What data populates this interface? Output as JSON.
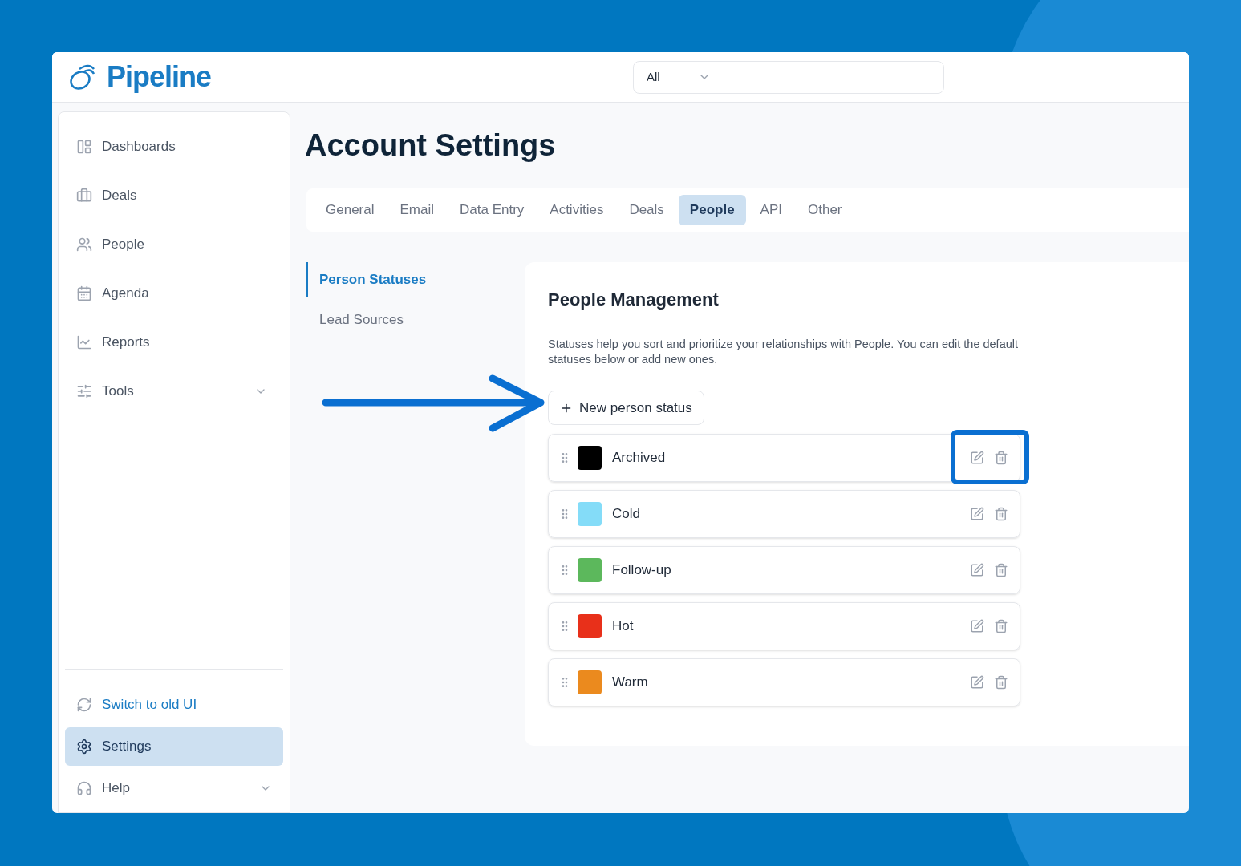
{
  "header": {
    "logo": "Pipeline",
    "search": {
      "scope": "All"
    }
  },
  "sidebar": {
    "items": [
      {
        "label": "Dashboards",
        "expandable": false
      },
      {
        "label": "Deals",
        "expandable": false
      },
      {
        "label": "People",
        "expandable": false
      },
      {
        "label": "Agenda",
        "expandable": false
      },
      {
        "label": "Reports",
        "expandable": false
      },
      {
        "label": "Tools",
        "expandable": true
      }
    ],
    "bottom_items": [
      {
        "label": "Switch to old UI",
        "kind": "link",
        "selected": false,
        "expandable": false
      },
      {
        "label": "Settings",
        "kind": "item",
        "selected": true,
        "expandable": false
      },
      {
        "label": "Help",
        "kind": "item",
        "selected": false,
        "expandable": true
      }
    ]
  },
  "page": {
    "title": "Account Settings",
    "tabs": [
      {
        "label": "General",
        "selected": false
      },
      {
        "label": "Email",
        "selected": false
      },
      {
        "label": "Data Entry",
        "selected": false
      },
      {
        "label": "Activities",
        "selected": false
      },
      {
        "label": "Deals",
        "selected": false
      },
      {
        "label": "People",
        "selected": true
      },
      {
        "label": "API",
        "selected": false
      },
      {
        "label": "Other",
        "selected": false
      }
    ],
    "subnav": [
      {
        "label": "Person Statuses",
        "selected": true
      },
      {
        "label": "Lead Sources",
        "selected": false
      }
    ],
    "card": {
      "title": "People Management",
      "description": "Statuses help you sort and prioritize your relationships with People. You can edit the default statuses below or add new ones.",
      "new_button": "New person status",
      "statuses": [
        {
          "name": "Archived",
          "color": "#000000",
          "highlighted": true
        },
        {
          "name": "Cold",
          "color": "#84dcf8",
          "highlighted": false
        },
        {
          "name": "Follow-up",
          "color": "#5cb85c",
          "highlighted": false
        },
        {
          "name": "Hot",
          "color": "#e8301a",
          "highlighted": false
        },
        {
          "name": "Warm",
          "color": "#eb8a1e",
          "highlighted": false
        }
      ]
    }
  }
}
